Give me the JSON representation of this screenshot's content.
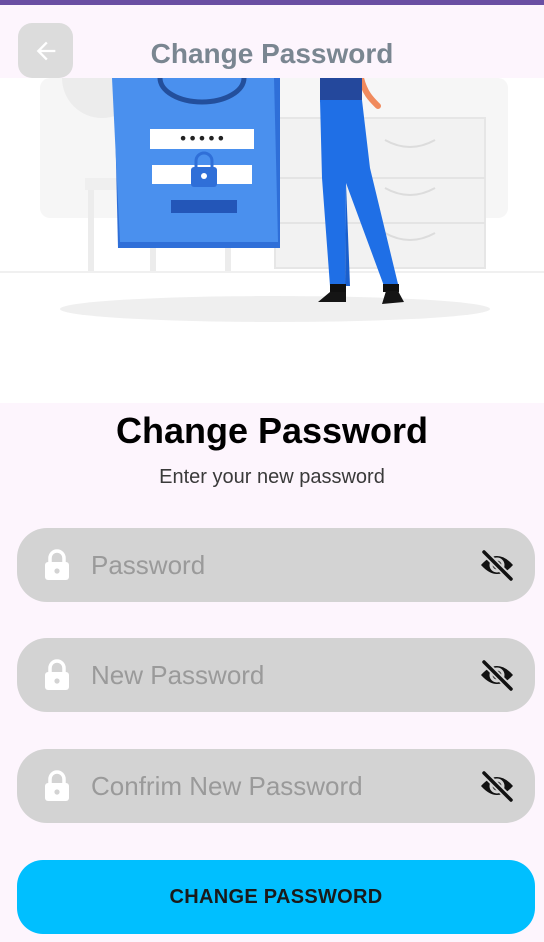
{
  "header": {
    "title": "Change Password",
    "back_icon": "arrow-left-icon"
  },
  "hero": {
    "masked_value": "•••••"
  },
  "content": {
    "heading": "Change Password",
    "subheading": "Enter your new password"
  },
  "form": {
    "fields": [
      {
        "placeholder": "Password",
        "value": "",
        "leading_icon": "lock-icon",
        "trailing_icon": "eye-off-icon"
      },
      {
        "placeholder": "New Password",
        "value": "",
        "leading_icon": "lock-icon",
        "trailing_icon": "eye-off-icon"
      },
      {
        "placeholder": "Confrim New Password",
        "value": "",
        "leading_icon": "lock-icon",
        "trailing_icon": "eye-off-icon"
      }
    ],
    "submit_label": "CHANGE PASSWORD"
  },
  "colors": {
    "accent": "#00bfff",
    "status_bar": "#6a4fa3",
    "background": "#fdf5fd",
    "field_background": "#d3d3d3"
  }
}
